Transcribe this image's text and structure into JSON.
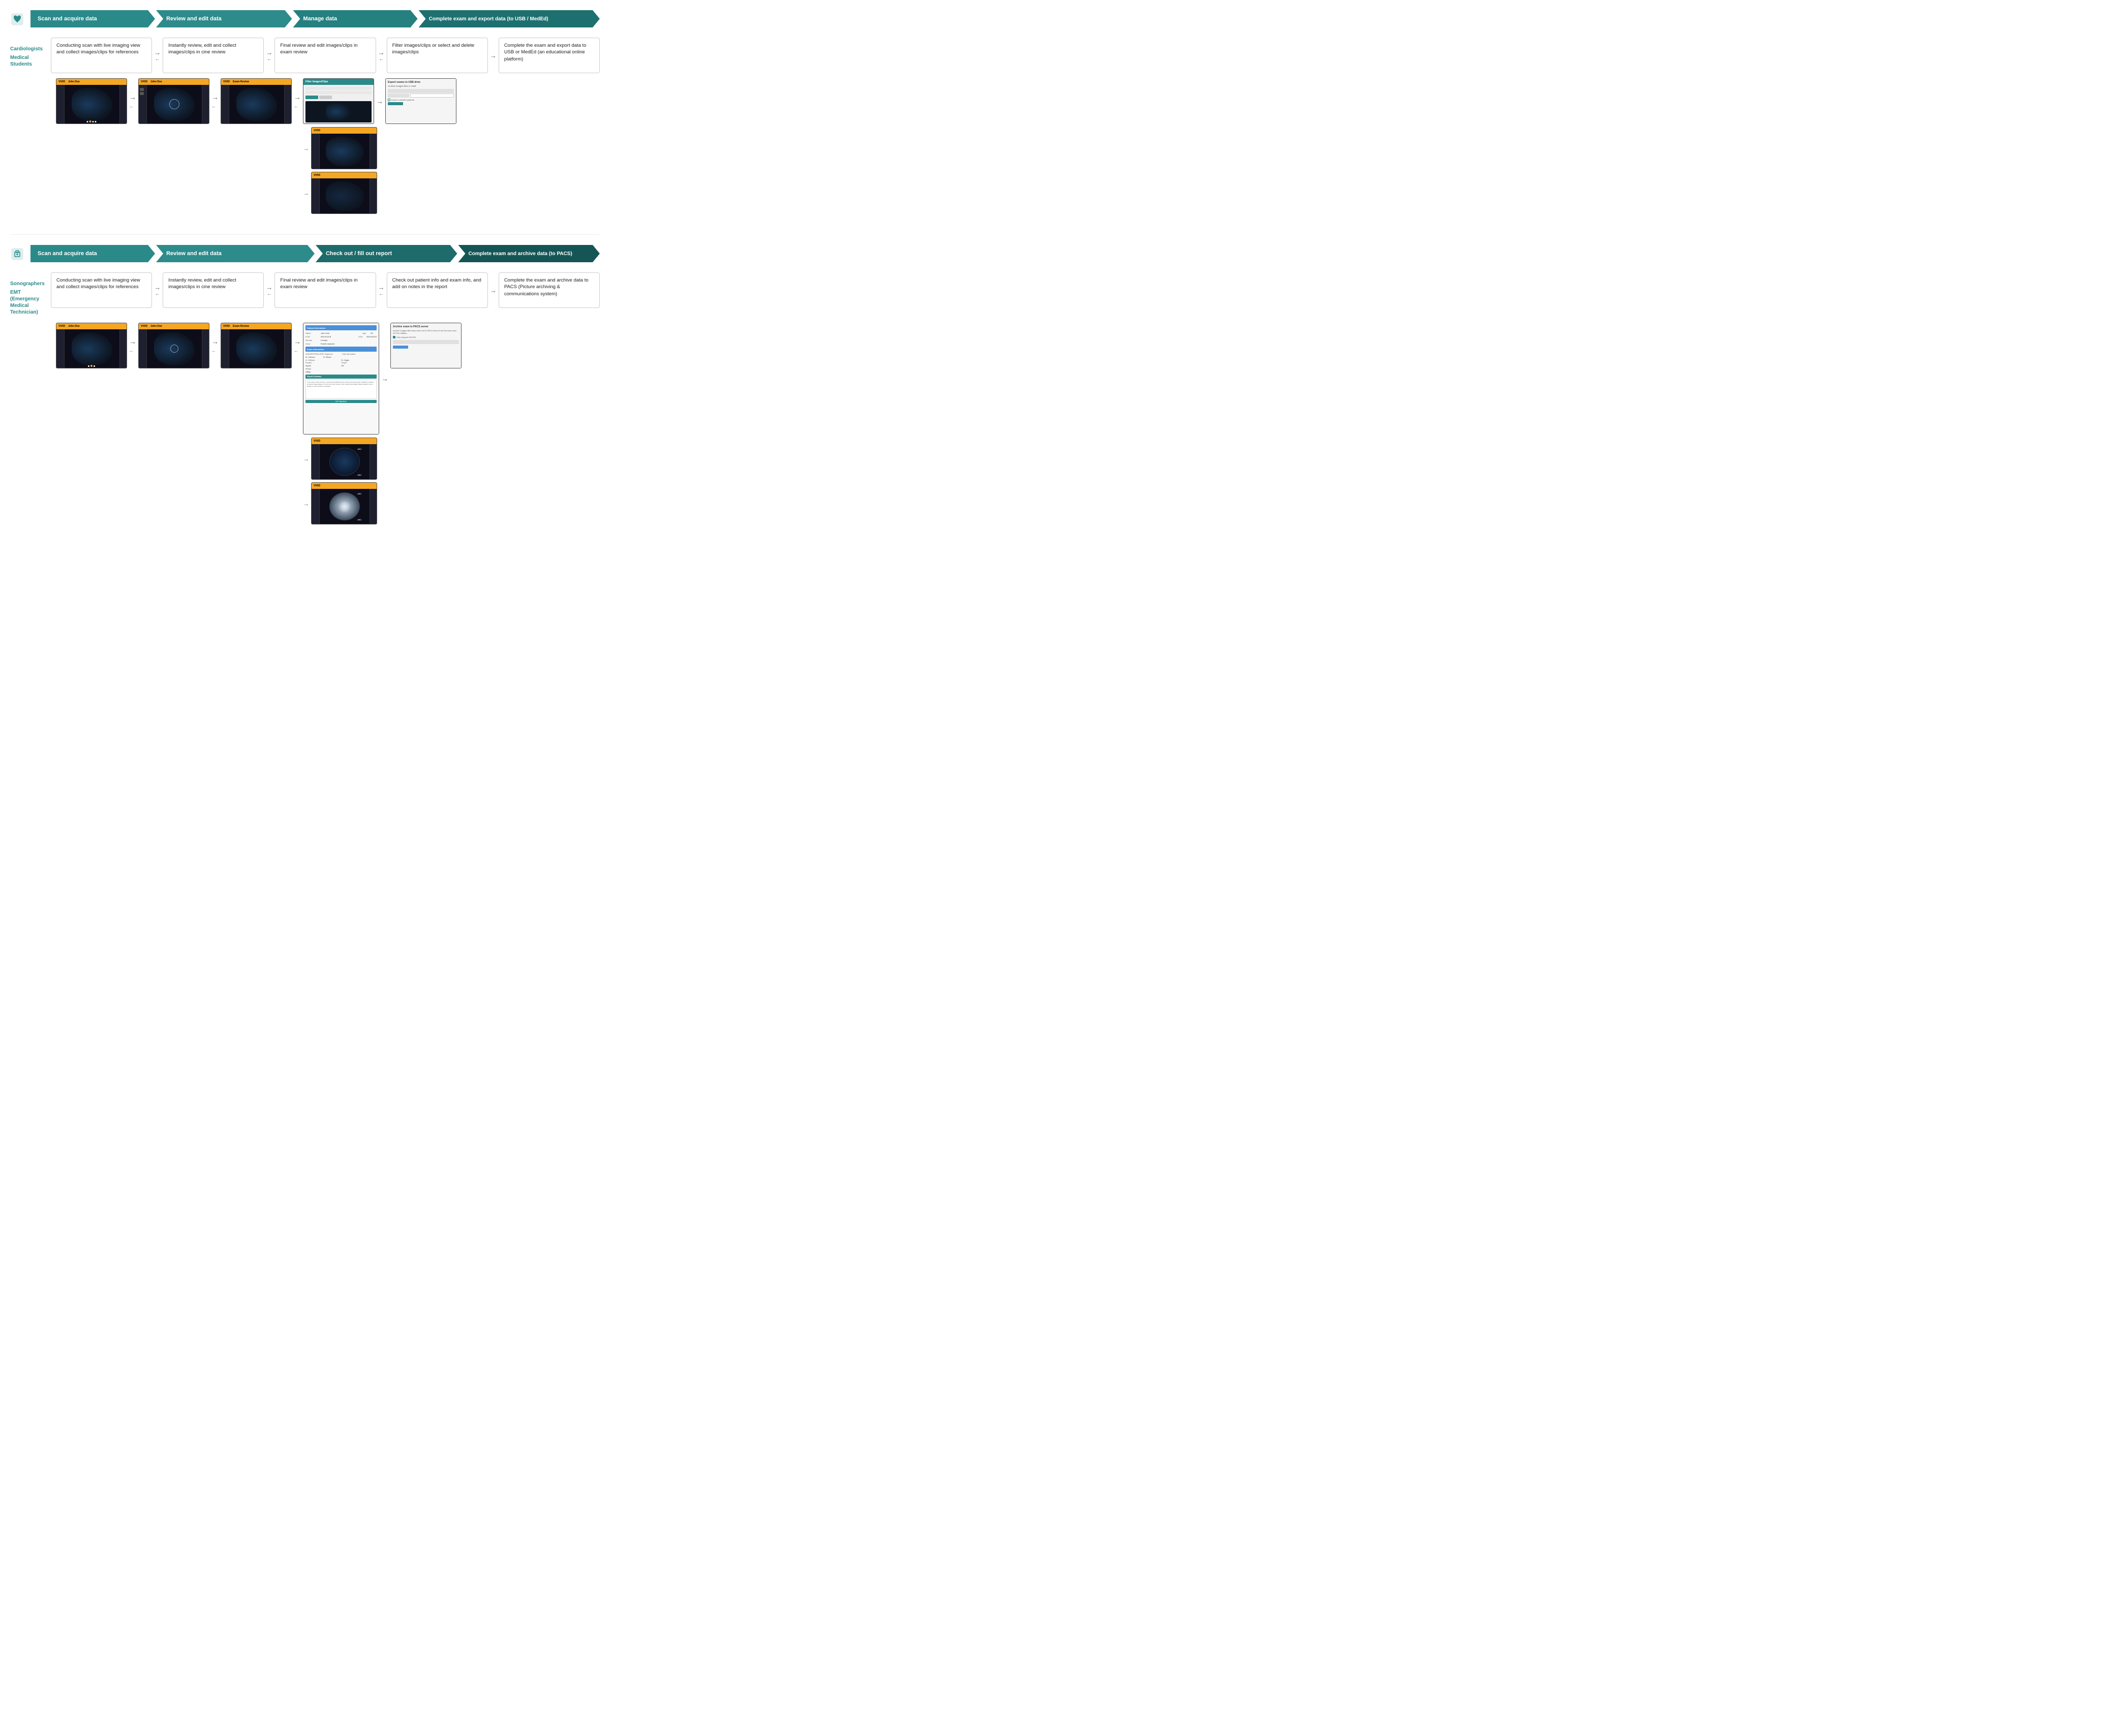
{
  "sections": [
    {
      "id": "cardiologist",
      "icon_type": "heart",
      "phases": [
        {
          "label": "Scan and acquire data",
          "color": "teal",
          "width": "22%"
        },
        {
          "label": "Review and edit data",
          "color": "teal",
          "width": "24%"
        },
        {
          "label": "Manage data",
          "color": "teal",
          "width": "22%"
        },
        {
          "label": "Complete exam and export data (to USB / MedEd)",
          "color": "teal",
          "width": "32%"
        }
      ],
      "roles": [
        {
          "label": "Cardiologists",
          "color": "teal"
        },
        {
          "label": "Medical Students",
          "color": "teal"
        }
      ],
      "steps": [
        {
          "text": "Conducting scan with live imaging view and collect images/clips for references"
        },
        {
          "text": "Instantly review, edit and collect images/clips in cine review"
        },
        {
          "text": "Final review and edit images/clips in exam review"
        },
        {
          "text": "Filter images/clips or select and delete images/clips"
        },
        {
          "text": "Complete the exam and export data to USB or MedEd (an educational online platform)"
        }
      ],
      "screenshots": [
        {
          "type": "ultrasound"
        },
        {
          "type": "ultrasound_edit"
        },
        {
          "type": "ultrasound_review"
        },
        {
          "type": "filter",
          "has_sub": true,
          "sub": [
            {
              "type": "ultrasound_sub1"
            },
            {
              "type": "ultrasound_sub2"
            }
          ]
        },
        {
          "type": "export_dialog"
        }
      ]
    },
    {
      "id": "sonographer",
      "icon_type": "medical",
      "phases": [
        {
          "label": "Scan and acquire data",
          "color": "teal",
          "width": "22%"
        },
        {
          "label": "Review and edit data",
          "color": "teal",
          "width": "28%"
        },
        {
          "label": "Check out / fill out report",
          "color": "teal-dark",
          "width": "25%"
        },
        {
          "label": "Complete exam and archive data (to PACS)",
          "color": "teal-dark",
          "width": "25%"
        }
      ],
      "roles": [
        {
          "label": "Sonographers",
          "color": "teal"
        },
        {
          "label": "EMT (Emergency Medical Technician)",
          "color": "teal"
        }
      ],
      "steps": [
        {
          "text": "Conducting scan with live imaging view and collect images/clips for references"
        },
        {
          "text": "Instantly review, edit and collect images/clips in cine review"
        },
        {
          "text": "Final review and edit images/clips in exam review"
        },
        {
          "text": "Check out patient info and exam info, and add on notes in the report"
        },
        {
          "text": "Complete the exam and archive data to PACS (Picture archiving & communications system)"
        }
      ],
      "screenshots": [
        {
          "type": "ultrasound"
        },
        {
          "type": "ultrasound_edit"
        },
        {
          "type": "ultrasound_review"
        },
        {
          "type": "report",
          "has_sub": true,
          "sub": [
            {
              "type": "report_sub1"
            },
            {
              "type": "report_sub2"
            }
          ]
        },
        {
          "type": "pacs_dialog"
        }
      ]
    }
  ],
  "arrows": {
    "right": "→",
    "left": "←",
    "right_left_combo": "⇄"
  },
  "colors": {
    "teal": "#2a8a8a",
    "teal_dark": "#1d6b6b",
    "orange": "#f5a623",
    "dark_bg": "#0d0d1a"
  }
}
